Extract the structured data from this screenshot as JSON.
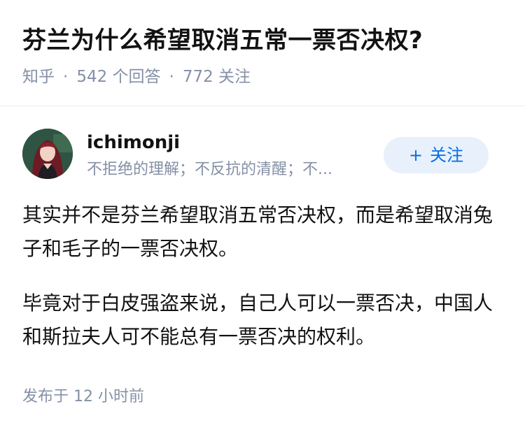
{
  "question": {
    "title": "芬兰为什么希望取消五常一票否决权?",
    "source": "知乎",
    "separator": "·",
    "answer_count": "542 个回答",
    "follower_count": "772 关注"
  },
  "author": {
    "name": "ichimonji",
    "bio": "不拒绝的理解；不反抗的清醒；不...",
    "avatar_icon": "avatar-portrait",
    "follow_icon": "plus",
    "follow_label": "关注"
  },
  "answer": {
    "paragraphs": [
      "其实并不是芬兰希望取消五常否决权，而是希望取消兔子和毛子的一票否决权。",
      "毕竟对于白皮强盗来说，自己人可以一票否决，中国人和斯拉夫人可不能总有一票否决的权利。"
    ],
    "time": "发布于 12 小时前"
  },
  "colors": {
    "text": "#121212",
    "meta": "#8590a6",
    "accent": "#056de8",
    "button_bg": "#e8f1fb",
    "divider": "#ebebeb"
  }
}
